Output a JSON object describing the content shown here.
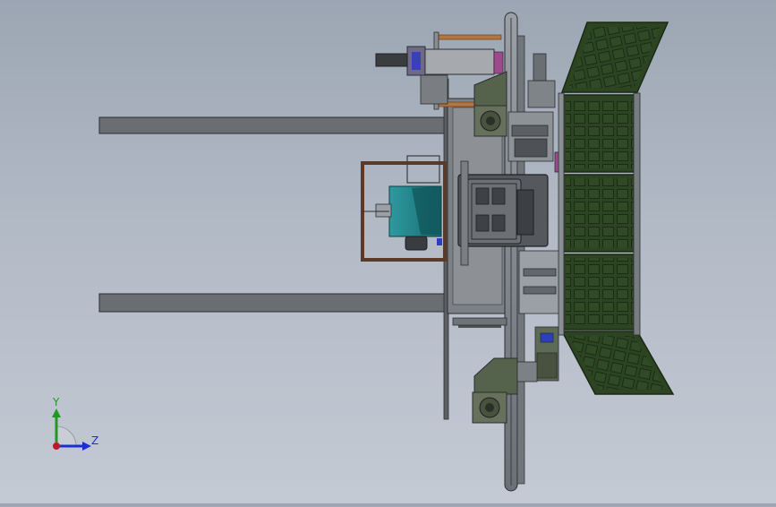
{
  "viewport": {
    "background_top": "#9ca6b3",
    "background_bottom": "#c4cad4",
    "model_palette": {
      "panel_green": "#3d5a2e",
      "frame_gray": "#5f6367",
      "steel": "#8b9096",
      "motor_teal": "#1f7f86",
      "copper_rod": "#b4753f",
      "motor_olive": "#56634c"
    }
  },
  "triad": {
    "y_label": "Y",
    "z_label": "Z",
    "y_color": "#1f9a1f",
    "z_color": "#1c2fcf",
    "x_color": "#c0182a"
  }
}
